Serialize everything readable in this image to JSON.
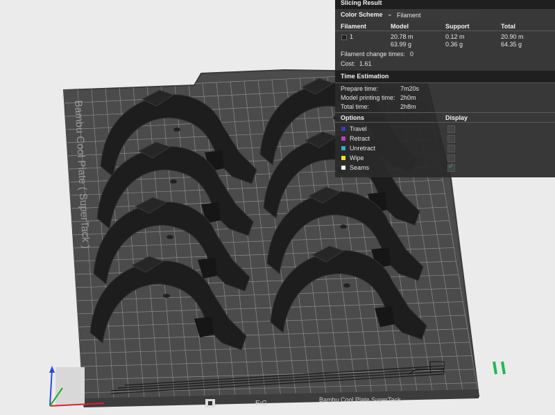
{
  "slicing_result": {
    "title": "Slicing Result",
    "color_scheme_label": "Color Scheme",
    "color_scheme_value": "Filament",
    "columns": [
      "Filament",
      "Model",
      "Support",
      "Total"
    ],
    "filament_rows": [
      {
        "id": "1",
        "model_len": "20.78 m",
        "model_wt": "63.99 g",
        "support_len": "0.12 m",
        "support_wt": "0.36 g",
        "total_len": "20.90 m",
        "total_wt": "64.35 g",
        "color": "#2a2a2a"
      }
    ],
    "filament_change_label": "Filament change times:",
    "filament_change_value": "0",
    "cost_label": "Cost:",
    "cost_value": "1.61"
  },
  "time_estimation": {
    "title": "Time Estimation",
    "rows": [
      {
        "label": "Prepare time:",
        "value": "7m20s"
      },
      {
        "label": "Model printing time:",
        "value": "2h0m"
      },
      {
        "label": "Total time:",
        "value": "2h8m"
      }
    ]
  },
  "options": {
    "title": "Options",
    "display_label": "Display",
    "items": [
      {
        "label": "Travel",
        "color": "#3b3bb5",
        "checked": false
      },
      {
        "label": "Retract",
        "color": "#c040c0",
        "checked": false
      },
      {
        "label": "Unretract",
        "color": "#30b0c0",
        "checked": false
      },
      {
        "label": "Wipe",
        "color": "#e8e820",
        "checked": false
      },
      {
        "label": "Seams",
        "color": "#f0f0f0",
        "checked": true
      }
    ]
  },
  "plate": {
    "side_label": "Bambu Cool Plate ( SuperTack )",
    "front_label": "Bambu Cool Plate   SuperTack",
    "front_code": "EıG"
  },
  "colors": {
    "panel_bg": "#2a2a2a",
    "header_bg": "#1f1f1f",
    "plate": "#4e4e4e",
    "grid": "#8a8a8a",
    "accent_green": "#1db954"
  }
}
